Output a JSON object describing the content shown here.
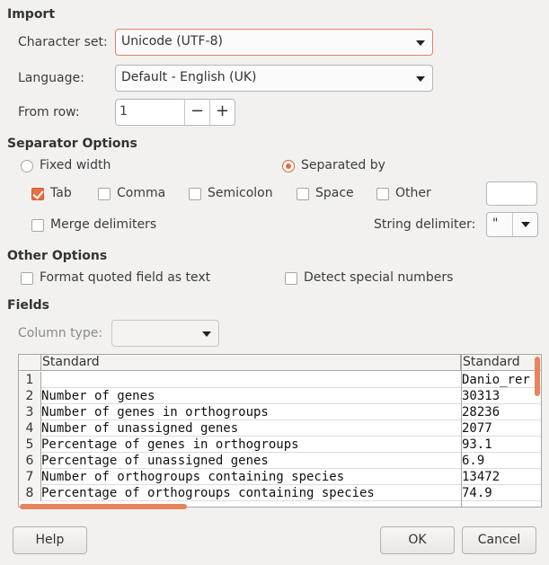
{
  "import": {
    "title": "Import",
    "charset_label": "Character set:",
    "charset_value": "Unicode (UTF-8)",
    "language_label": "Language:",
    "language_value": "Default - English (UK)",
    "from_row_label": "From row:",
    "from_row_value": "1",
    "minus": "−",
    "plus": "+"
  },
  "separator": {
    "title": "Separator Options",
    "fixed_width": "Fixed width",
    "separated_by": "Separated by",
    "mode": "separated_by",
    "tab": "Tab",
    "comma": "Comma",
    "semicolon": "Semicolon",
    "space": "Space",
    "other": "Other",
    "other_value": "",
    "merge_delimiters": "Merge delimiters",
    "string_delimiter_label": "String delimiter:",
    "string_delimiter_value": "\"",
    "checked": {
      "tab": true,
      "comma": false,
      "semicolon": false,
      "space": false,
      "other": false,
      "merge": false
    }
  },
  "other_options": {
    "title": "Other Options",
    "format_quoted": "Format quoted field as text",
    "detect_special": "Detect special numbers"
  },
  "fields": {
    "title": "Fields",
    "column_type_label": "Column type:",
    "column_type_value": "",
    "headers": [
      "Standard",
      "Standard"
    ],
    "rows": [
      {
        "n": "1",
        "a": "",
        "b": "Danio_rer"
      },
      {
        "n": "2",
        "a": "Number of genes",
        "b": "30313"
      },
      {
        "n": "3",
        "a": "Number of genes in orthogroups",
        "b": "28236"
      },
      {
        "n": "4",
        "a": "Number of unassigned genes",
        "b": "2077"
      },
      {
        "n": "5",
        "a": "Percentage of genes in orthogroups",
        "b": "93.1"
      },
      {
        "n": "6",
        "a": "Percentage of unassigned genes",
        "b": "6.9"
      },
      {
        "n": "7",
        "a": "Number of orthogroups containing species",
        "b": "13472"
      },
      {
        "n": "8",
        "a": "Percentage of orthogroups containing species",
        "b": "74.9"
      }
    ]
  },
  "buttons": {
    "help": "Help",
    "ok": "OK",
    "cancel": "Cancel"
  },
  "colors": {
    "accent": "#e86d3f",
    "background": "#f2f1f0"
  }
}
